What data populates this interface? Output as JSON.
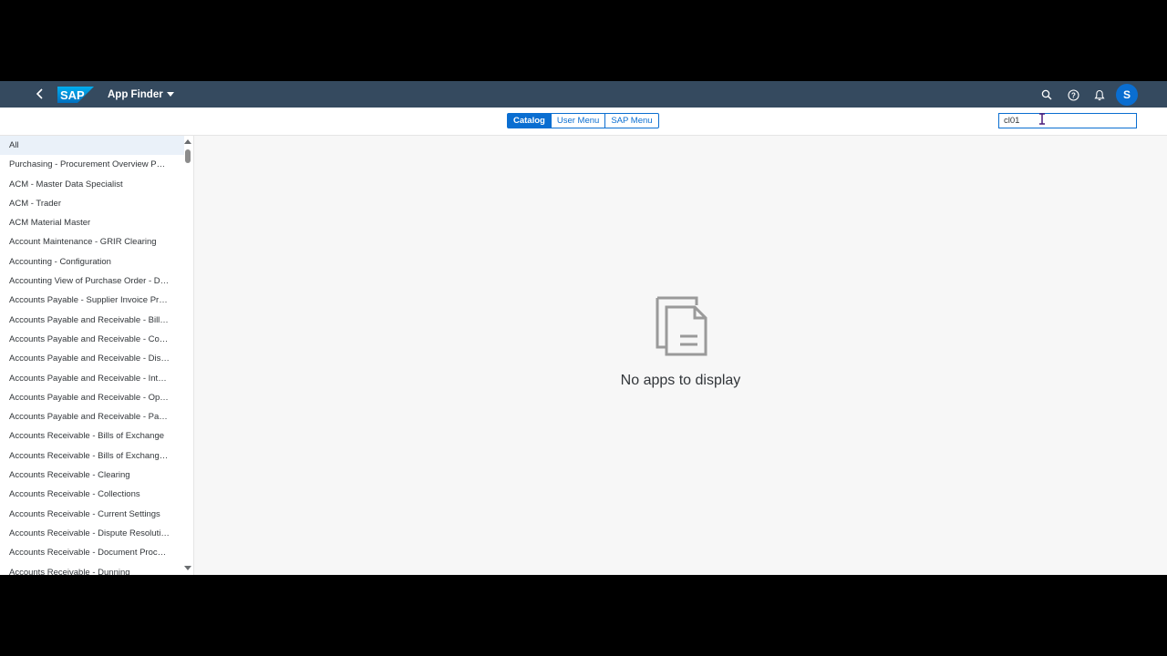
{
  "header": {
    "logo_text": "SAP",
    "app_title": "App Finder",
    "avatar_initial": "S"
  },
  "tabs": [
    {
      "label": "Catalog",
      "active": true
    },
    {
      "label": "User Menu",
      "active": false
    },
    {
      "label": "SAP Menu",
      "active": false
    }
  ],
  "search": {
    "value": "cl01"
  },
  "catalogs": [
    "All",
    "Purchasing - Procurement Overview Page",
    "ACM - Master Data Specialist",
    "ACM - Trader",
    "ACM Material Master",
    "Account Maintenance - GRIR Clearing",
    "Accounting - Configuration",
    "Accounting View of Purchase Order - Dis...",
    "Accounts Payable - Supplier Invoice Proc...",
    "Accounts Payable and Receivable - Bills ...",
    "Accounts Payable and Receivable - Corr...",
    "Accounts Payable and Receivable - Displ...",
    "Accounts Payable and Receivable - Inter...",
    "Accounts Payable and Receivable - Oper...",
    "Accounts Payable and Receivable - Pay...",
    "Accounts Receivable - Bills of Exchange",
    "Accounts Receivable - Bills of Exchange ...",
    "Accounts Receivable - Clearing",
    "Accounts Receivable - Collections",
    "Accounts Receivable - Current Settings",
    "Accounts Receivable - Dispute Resolution",
    "Accounts Receivable - Document Proces...",
    "Accounts Receivable - Dunning"
  ],
  "selected_catalog_index": 0,
  "empty_state": {
    "message": "No apps to display",
    "icon": "document-stack-icon"
  },
  "colors": {
    "shell": "#354a5f",
    "accent": "#0a6ed1",
    "background": "#f7f7f7"
  }
}
